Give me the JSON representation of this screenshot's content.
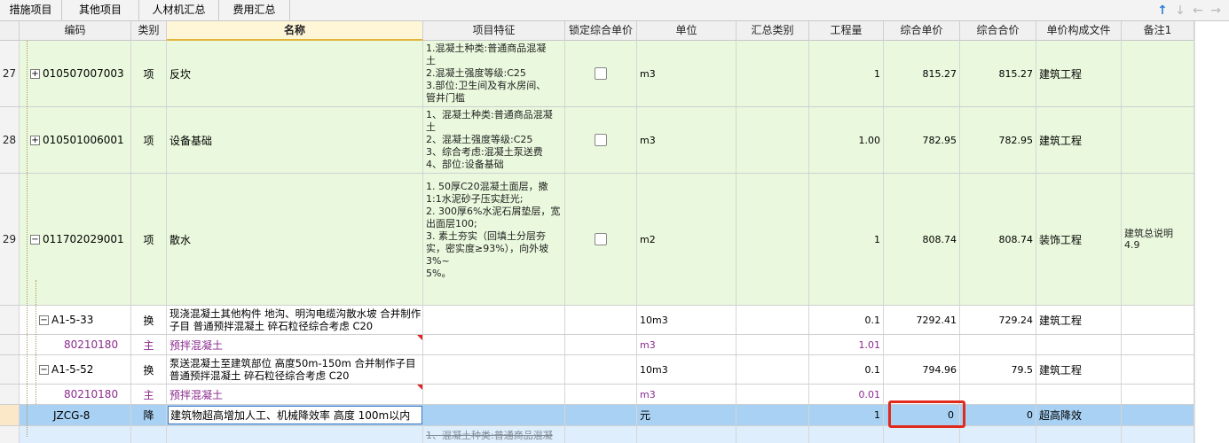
{
  "tabs": [
    "措施项目",
    "其他项目",
    "人材机汇总",
    "费用汇总"
  ],
  "toolbar": {
    "arrows": [
      "↑",
      "↓",
      "←",
      "→"
    ]
  },
  "columns": [
    "编码",
    "类别",
    "名称",
    "项目特征",
    "锁定综合单价",
    "单位",
    "汇总类别",
    "工程量",
    "综合单价",
    "综合合价",
    "单价构成文件",
    "备注1"
  ],
  "rows": [
    {
      "num": "27",
      "fold": "+",
      "code": "010507007003",
      "type": "项",
      "name": "反坎",
      "feature": "1.混凝土种类:普通商品混凝\n土\n2.混凝土强度等级:C25\n3.部位:卫生间及有水房间、\n管井门槛",
      "lock": false,
      "unit": "m3",
      "qty": "1",
      "price": "815.27",
      "total": "815.27",
      "file": "建筑工程",
      "note": ""
    },
    {
      "num": "28",
      "fold": "+",
      "code": "010501006001",
      "type": "项",
      "name": "设备基础",
      "feature": "1、混凝土种类:普通商品混凝\n土\n2、混凝土强度等级:C25\n3、综合考虑:混凝土泵送费\n4、部位:设备基础",
      "lock": false,
      "unit": "m3",
      "qty": "1.00",
      "price": "782.95",
      "total": "782.95",
      "file": "建筑工程",
      "note": ""
    },
    {
      "num": "29",
      "fold": "−",
      "code": "011702029001",
      "type": "项",
      "name": "散水",
      "feature": "1. 50厚C20混凝土面层，撒\n1:1水泥砂子压实赶光;\n2. 300厚6%水泥石屑垫层，宽\n出面层100;\n3. 素土夯实（回填土分层夯\n实，密实度≥93%），向外坡\n3%~\n5%。",
      "lock": false,
      "unit": "m2",
      "qty": "1",
      "price": "808.74",
      "total": "808.74",
      "file": "装饰工程",
      "note": "建筑总说明\n4.9"
    },
    {
      "num": "",
      "fold": "−",
      "code": "A1-5-33",
      "type": "换",
      "name": "现浇混凝土其他构件 地沟、明沟电缆沟散水坡  合并制作子目 普通预拌混凝土 碎石粒径综合考虑 C20",
      "feature": "",
      "unit": "10m3",
      "qty": "0.1",
      "price": "7292.41",
      "total": "729.24",
      "file": "建筑工程",
      "note": ""
    },
    {
      "num": "",
      "fold": "",
      "code": "80210180",
      "type": "主",
      "name": "预拌混凝土",
      "feature": "",
      "unit": "m3",
      "qty": "1.01",
      "price": "",
      "total": "",
      "file": "",
      "note": ""
    },
    {
      "num": "",
      "fold": "−",
      "code": "A1-5-52",
      "type": "换",
      "name": "泵送混凝土至建筑部位 高度50m-150m  合并制作子目 普通预拌混凝土 碎石粒径综合考虑 C20",
      "feature": "",
      "unit": "10m3",
      "qty": "0.1",
      "price": "794.96",
      "total": "79.5",
      "file": "建筑工程",
      "note": ""
    },
    {
      "num": "",
      "fold": "",
      "code": "80210180",
      "type": "主",
      "name": "预拌混凝土",
      "feature": "",
      "unit": "m3",
      "qty": "0.01",
      "price": "",
      "total": "",
      "file": "",
      "note": ""
    },
    {
      "num": "",
      "fold": "",
      "code": "JZCG-8",
      "type": "降",
      "name": "建筑物超高增加人工、机械降效率 高度 100m以内",
      "feature": "",
      "unit": "元",
      "qty": "1",
      "price": "0",
      "total": "0",
      "file": "超高降效",
      "note": ""
    },
    {
      "num": "",
      "fold": "",
      "code": "",
      "type": "",
      "name": "",
      "feature": "1、混凝土种类:普通商品混凝",
      "unit": "",
      "qty": "",
      "price": "",
      "total": "",
      "file": "",
      "note": ""
    }
  ],
  "colors": {
    "greenRow": "#eaf9dd",
    "selectedRow": "#a8d1f3",
    "purple": "#8b2a8f",
    "highlight": "#e02a1c"
  }
}
